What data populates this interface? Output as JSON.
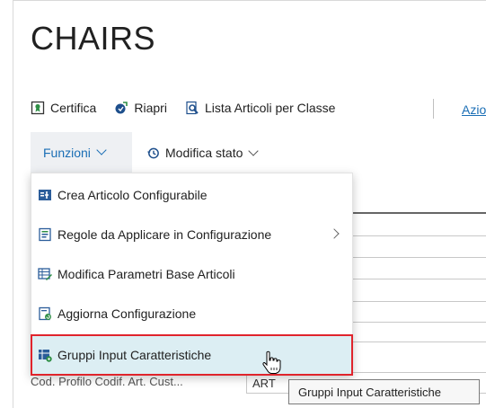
{
  "page": {
    "title": "CHAIRS"
  },
  "actions": [
    {
      "label": "Certifica",
      "icon": "certificate-icon"
    },
    {
      "label": "Riapri",
      "icon": "reopen-icon"
    },
    {
      "label": "Lista Articoli per Classe",
      "icon": "search-list-icon"
    }
  ],
  "actions_overflow": "Azio",
  "funzioni": {
    "label": "Funzioni"
  },
  "modifica_stato": {
    "label": "Modifica stato"
  },
  "menu": {
    "items": [
      {
        "label": "Crea Articolo Configurabile",
        "icon": "create-item-icon",
        "submenu": false
      },
      {
        "label": "Regole da Applicare in Configurazione",
        "icon": "rules-icon",
        "submenu": true
      },
      {
        "label": "Modifica Parametri Base Articoli",
        "icon": "edit-table-icon",
        "submenu": false
      },
      {
        "label": "Aggiorna Configurazione",
        "icon": "update-config-icon",
        "submenu": false
      },
      {
        "label": "Gruppi Input Caratteristiche",
        "icon": "groups-input-icon",
        "submenu": false,
        "selected": true
      }
    ]
  },
  "background": {
    "field_label": "Cod. Profilo Codif. Art. Cust...",
    "field_value": "ART"
  },
  "tooltip": {
    "text": "Gruppi Input Caratteristiche"
  },
  "colors": {
    "accent": "#1a6eb5",
    "selection_bg": "#dceef3",
    "highlight_border": "#e0242c"
  }
}
